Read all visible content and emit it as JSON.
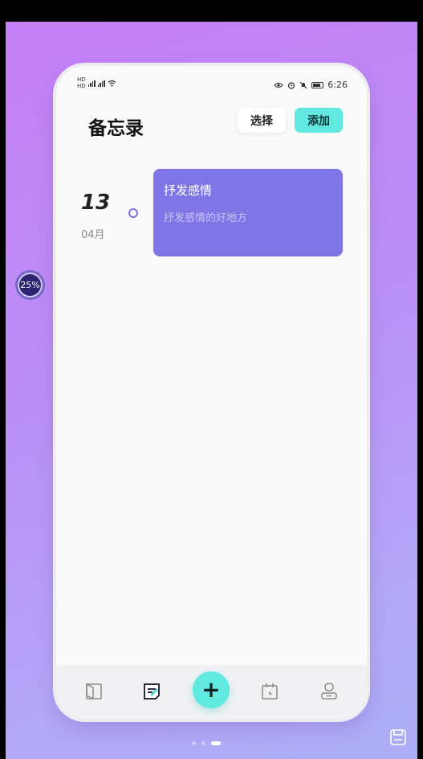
{
  "status_bar": {
    "time": "6:26",
    "left_label_1": "HD",
    "left_label_2": "HD",
    "icons": [
      "signal-icon",
      "wifi-icon",
      "eye-icon",
      "alarm-icon",
      "mute-icon",
      "battery-icon"
    ]
  },
  "header": {
    "title": "备忘录",
    "select_label": "选择",
    "add_label": "添加"
  },
  "memos": [
    {
      "day": "13",
      "month": "04月",
      "title": "抒发感情",
      "content": "抒发感情的好地方"
    }
  ],
  "floating_ball": {
    "value": "25%"
  },
  "tabbar": {
    "items": [
      "book-icon",
      "memo-icon",
      "add-icon",
      "calendar-icon",
      "profile-icon"
    ],
    "active": "memo-icon"
  },
  "colors": {
    "accent": "#61e9e1",
    "memo_card": "#7f75e6",
    "background_top": "#c47ff6",
    "background_bottom": "#acaef6"
  }
}
